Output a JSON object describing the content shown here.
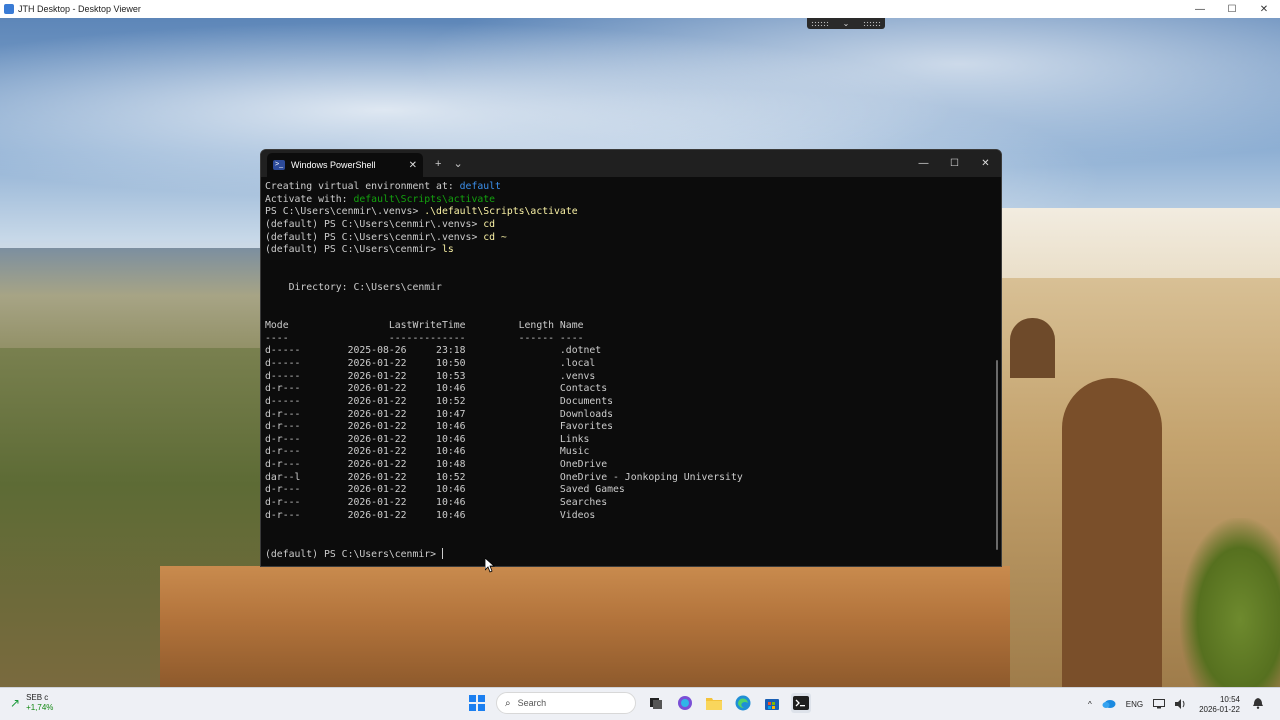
{
  "viewer": {
    "title": "JTH Desktop - Desktop Viewer",
    "minimize": "—",
    "maximize": "☐",
    "close": "✕"
  },
  "remote_toolbar": {
    "chevron": "⌄"
  },
  "powershell": {
    "tab_title": "Windows PowerShell",
    "tab_close": "✕",
    "new_tab": "+",
    "dropdown": "⌄",
    "minimize": "—",
    "maximize": "☐",
    "close": "✕",
    "lines": [
      {
        "segments": [
          {
            "text": "Creating virtual environment at: ",
            "cls": ""
          },
          {
            "text": "default",
            "cls": "c-blue"
          }
        ]
      },
      {
        "segments": [
          {
            "text": "Activate with: ",
            "cls": ""
          },
          {
            "text": "default\\Scripts\\activate",
            "cls": "c-green"
          }
        ]
      },
      {
        "segments": [
          {
            "text": "PS C:\\Users\\cenmir\\.venvs> ",
            "cls": ""
          },
          {
            "text": ".\\default\\Scripts\\activate",
            "cls": "c-yellow"
          }
        ]
      },
      {
        "segments": [
          {
            "text": "(default) PS C:\\Users\\cenmir\\.venvs> ",
            "cls": ""
          },
          {
            "text": "cd",
            "cls": "c-yellow"
          }
        ]
      },
      {
        "segments": [
          {
            "text": "(default) PS C:\\Users\\cenmir\\.venvs> ",
            "cls": ""
          },
          {
            "text": "cd ~",
            "cls": "c-yellow"
          }
        ]
      },
      {
        "segments": [
          {
            "text": "(default) PS C:\\Users\\cenmir> ",
            "cls": ""
          },
          {
            "text": "ls",
            "cls": "c-yellow"
          }
        ]
      },
      {
        "segments": []
      },
      {
        "segments": []
      },
      {
        "segments": [
          {
            "text": "    Directory: C:\\Users\\cenmir",
            "cls": ""
          }
        ]
      },
      {
        "segments": []
      },
      {
        "segments": []
      },
      {
        "segments": [
          {
            "text": "Mode                 LastWriteTime         Length Name",
            "cls": ""
          }
        ]
      },
      {
        "segments": [
          {
            "text": "----                 -------------         ------ ----",
            "cls": ""
          }
        ]
      },
      {
        "segments": [
          {
            "text": "d-----        2025-08-26     23:18                .dotnet",
            "cls": ""
          }
        ]
      },
      {
        "segments": [
          {
            "text": "d-----        2026-01-22     10:50                .local",
            "cls": ""
          }
        ]
      },
      {
        "segments": [
          {
            "text": "d-----        2026-01-22     10:53                .venvs",
            "cls": ""
          }
        ]
      },
      {
        "segments": [
          {
            "text": "d-r---        2026-01-22     10:46                Contacts",
            "cls": ""
          }
        ]
      },
      {
        "segments": [
          {
            "text": "d-----        2026-01-22     10:52                Documents",
            "cls": ""
          }
        ]
      },
      {
        "segments": [
          {
            "text": "d-r---        2026-01-22     10:47                Downloads",
            "cls": ""
          }
        ]
      },
      {
        "segments": [
          {
            "text": "d-r---        2026-01-22     10:46                Favorites",
            "cls": ""
          }
        ]
      },
      {
        "segments": [
          {
            "text": "d-r---        2026-01-22     10:46                Links",
            "cls": ""
          }
        ]
      },
      {
        "segments": [
          {
            "text": "d-r---        2026-01-22     10:46                Music",
            "cls": ""
          }
        ]
      },
      {
        "segments": [
          {
            "text": "d-r---        2026-01-22     10:48                OneDrive",
            "cls": ""
          }
        ]
      },
      {
        "segments": [
          {
            "text": "dar--l        2026-01-22     10:52                OneDrive - Jonkoping University",
            "cls": ""
          }
        ]
      },
      {
        "segments": [
          {
            "text": "d-r---        2026-01-22     10:46                Saved Games",
            "cls": ""
          }
        ]
      },
      {
        "segments": [
          {
            "text": "d-r---        2026-01-22     10:46                Searches",
            "cls": ""
          }
        ]
      },
      {
        "segments": [
          {
            "text": "d-r---        2026-01-22     10:46                Videos",
            "cls": ""
          }
        ]
      },
      {
        "segments": []
      },
      {
        "segments": []
      },
      {
        "segments": [
          {
            "text": "(default) PS C:\\Users\\cenmir> ",
            "cls": ""
          }
        ],
        "cursor": true
      }
    ]
  },
  "taskbar": {
    "widget": {
      "ticker": "SEB c",
      "change": "+1,74%"
    },
    "search_placeholder": "Search",
    "icons": [
      "task-view-icon",
      "copilot-icon",
      "file-explorer-icon",
      "edge-icon",
      "store-icon",
      "terminal-icon"
    ],
    "tray": {
      "overflow": "^",
      "language": "ENG",
      "time": "10:54",
      "date": "2026-01-22"
    }
  }
}
